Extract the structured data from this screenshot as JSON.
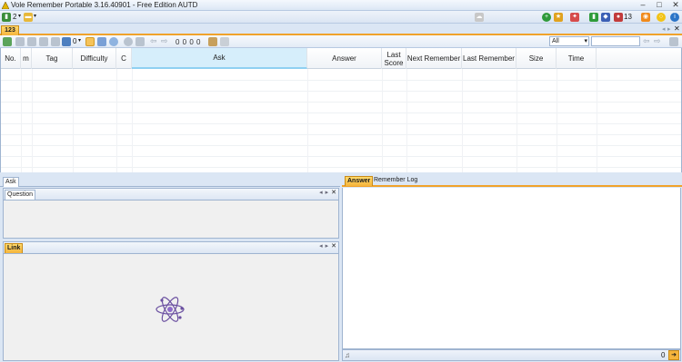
{
  "window": {
    "title": "Vole Remember Portable  3.16.40901 - Free Edition AUTD",
    "controls": [
      "–",
      "□",
      "✕"
    ]
  },
  "menubar": {
    "left_count": "2",
    "right_badge": "13"
  },
  "tabs": {
    "active": "123"
  },
  "toolbar": {
    "counter": "0 0 0 0",
    "filter_selected": "All",
    "filter_placeholder": "",
    "zero": "0"
  },
  "grid": {
    "columns": [
      {
        "label": "No."
      },
      {
        "label": "m"
      },
      {
        "label": "Tag"
      },
      {
        "label": "Difficulty"
      },
      {
        "label": "C"
      },
      {
        "label": "Ask"
      },
      {
        "label": "Answer"
      },
      {
        "label": "Last Score"
      },
      {
        "label": "Next Remember"
      },
      {
        "label": "Last Remember"
      },
      {
        "label": "Size"
      },
      {
        "label": "Time"
      }
    ],
    "rows": []
  },
  "ask_panel": {
    "tab": "Ask",
    "question_tab": "Question",
    "link_tab": "Link"
  },
  "answer_panel": {
    "tabs": [
      "Answer",
      "Remember Log"
    ],
    "status_count": "0"
  },
  "colors": {
    "accent_orange": "#f5b43c",
    "frame_blue": "#9fb4d0",
    "bg_blue": "#dbe6f4",
    "selected_column": "#d6eefb"
  }
}
